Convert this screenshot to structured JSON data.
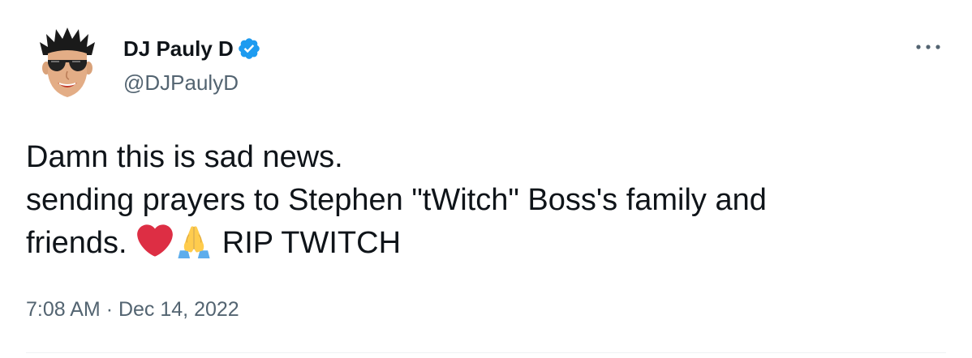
{
  "author": {
    "display_name": "DJ Pauly D",
    "handle": "@DJPaulyD",
    "verified": true,
    "verified_color": "#1d9bf0"
  },
  "tweet": {
    "line1": "Damn this is sad news.",
    "line2": "sending prayers to Stephen \"tWitch\" Boss's family and",
    "line3_before_emoji": "friends.",
    "emojis": [
      "red-heart-icon",
      "folded-hands-icon"
    ],
    "line3_after_emoji": "RIP TWITCH"
  },
  "meta": {
    "time": "7:08 AM",
    "separator": "·",
    "date": "Dec 14, 2022"
  },
  "menu": {
    "icon": "more-horizontal-icon"
  }
}
